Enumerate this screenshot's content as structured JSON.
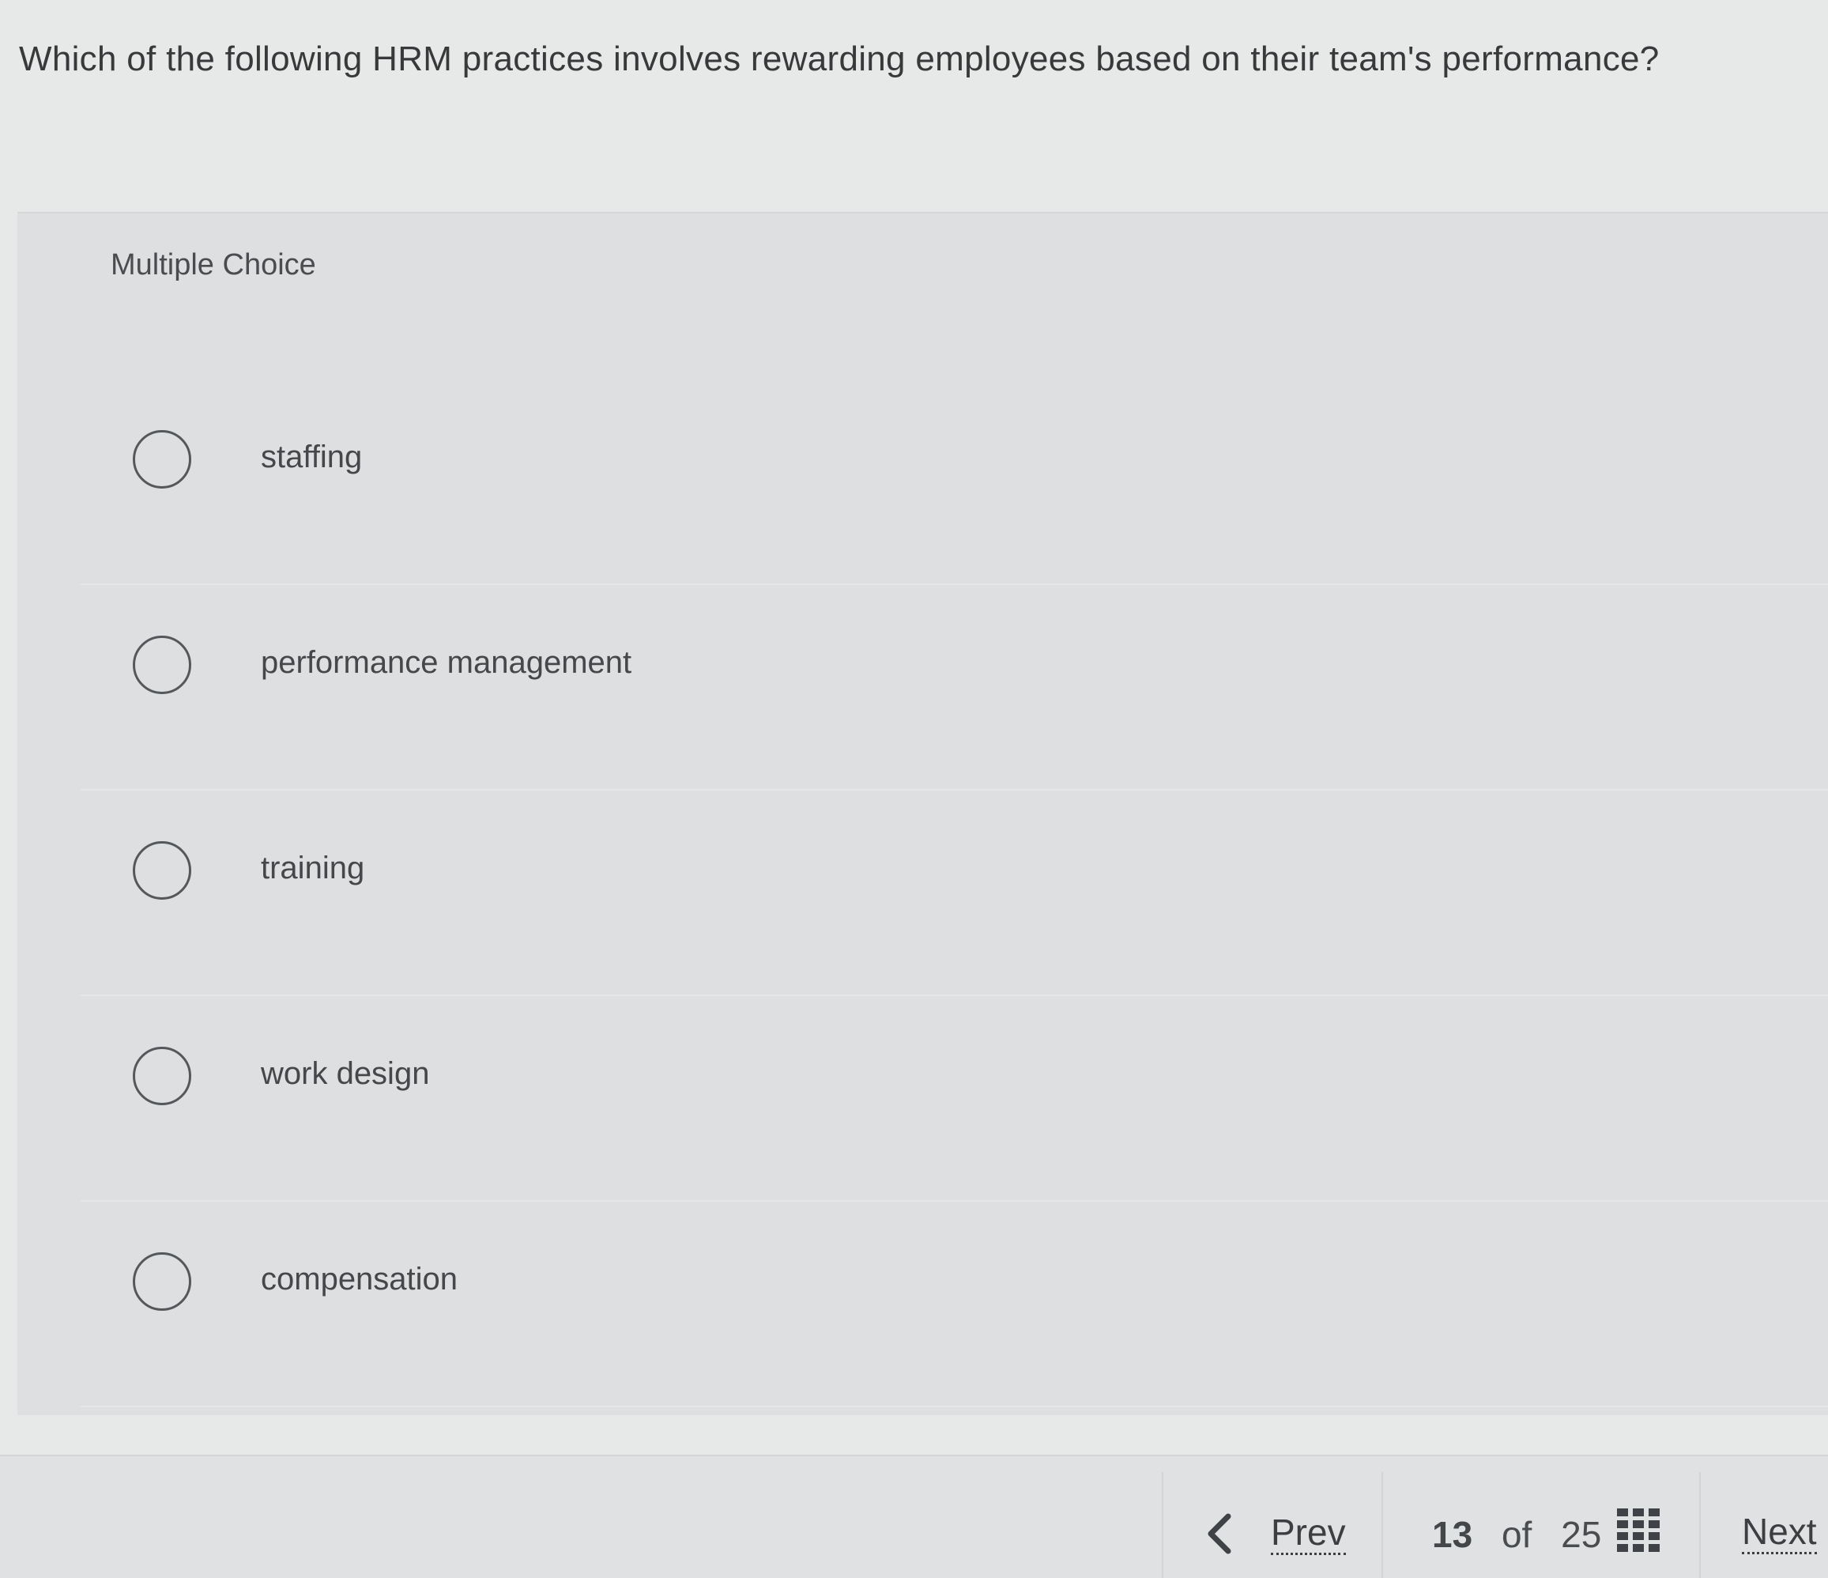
{
  "question": {
    "text": "Which of the following HRM practices involves rewarding employees based on their team's performance?"
  },
  "answer_panel": {
    "type_label": "Multiple Choice",
    "choices": [
      {
        "label": "staffing"
      },
      {
        "label": "performance management"
      },
      {
        "label": "training"
      },
      {
        "label": "work design"
      },
      {
        "label": "compensation"
      }
    ]
  },
  "footer": {
    "prev_label": "Prev",
    "current_page": "13",
    "of_label": "of",
    "total_pages": "25",
    "next_label": "Next",
    "prev_icon": "chevron-left-icon",
    "grid_icon": "grid-icon"
  }
}
